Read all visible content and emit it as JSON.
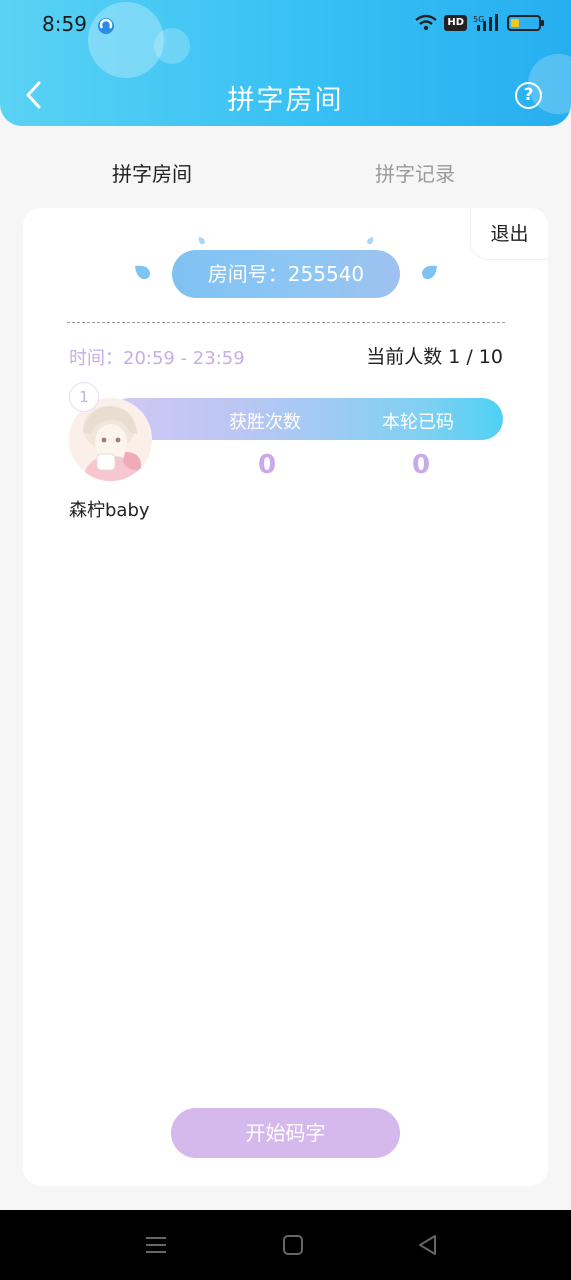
{
  "status_bar": {
    "time": "8:59",
    "hd_badge": "HD",
    "network": "5G"
  },
  "header": {
    "title": "拼字房间",
    "back_icon": "chevron-left-icon",
    "help_icon": "question-circle-icon",
    "help_glyph": "?"
  },
  "tabs": [
    {
      "label": "拼字房间",
      "active": true
    },
    {
      "label": "拼字记录",
      "active": false
    }
  ],
  "room": {
    "room_number": "房间号：255540",
    "exit_label": "退出",
    "time_range": "时间：20:59 - 23:59",
    "player_count": "当前人数 1 / 10"
  },
  "players": [
    {
      "rank": "1",
      "name": "森柠baby",
      "wins_label": "获胜次数",
      "typed_label": "本轮已码",
      "wins": "0",
      "typed": "0"
    }
  ],
  "actions": {
    "start_label": "开始码字"
  },
  "colors": {
    "header_gradient_start": "#5ad2f4",
    "header_gradient_end": "#27aef0",
    "accent_purple": "#c6aee6",
    "start_button": "#d6b9ec",
    "room_pill": "#8fc6f4"
  },
  "nav": {
    "menu_icon": "menu-icon",
    "home_icon": "home-square-icon",
    "back_icon": "triangle-back-icon"
  }
}
